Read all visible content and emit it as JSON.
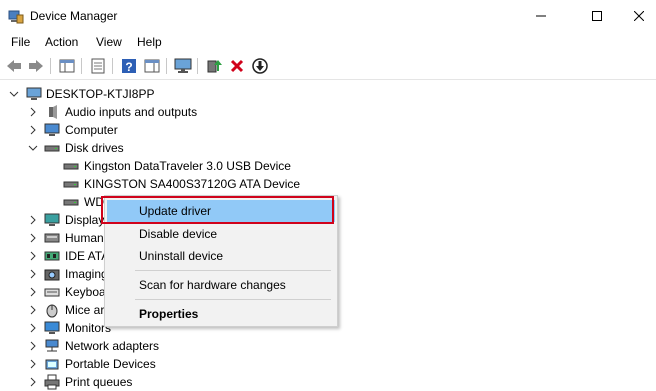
{
  "window": {
    "title": "Device Manager"
  },
  "menu": [
    "File",
    "Action",
    "View",
    "Help"
  ],
  "tree": {
    "root": "DESKTOP-KTJI8PP",
    "nodes": [
      {
        "label": "Audio inputs and outputs",
        "icon": "speaker-icon"
      },
      {
        "label": "Computer",
        "icon": "computer-icon"
      },
      {
        "label": "Disk drives",
        "icon": "disk-drive-icon"
      },
      {
        "label": "Kingston DataTraveler 3.0 USB Device",
        "icon": "drive-icon"
      },
      {
        "label": "KINGSTON SA400S37120G ATA Device",
        "icon": "drive-icon"
      },
      {
        "label": "WD",
        "icon": "drive-icon"
      },
      {
        "label": "Display",
        "icon": "display-icon"
      },
      {
        "label": "Human",
        "icon": "hid-icon"
      },
      {
        "label": "IDE ATA",
        "icon": "ide-icon"
      },
      {
        "label": "Imaging",
        "icon": "camera-icon"
      },
      {
        "label": "Keyboa",
        "icon": "keyboard-icon"
      },
      {
        "label": "Mice ar",
        "icon": "mouse-icon"
      },
      {
        "label": "Monitors",
        "icon": "monitor-icon"
      },
      {
        "label": "Network adapters",
        "icon": "network-icon"
      },
      {
        "label": "Portable Devices",
        "icon": "portable-device-icon"
      },
      {
        "label": "Print queues",
        "icon": "printer-icon"
      }
    ]
  },
  "context_menu": {
    "update": "Update driver",
    "disable": "Disable device",
    "uninstall": "Uninstall device",
    "scan": "Scan for hardware changes",
    "properties": "Properties"
  },
  "colors": {
    "highlight": "#91c9f7",
    "annotation": "#d0021b"
  }
}
